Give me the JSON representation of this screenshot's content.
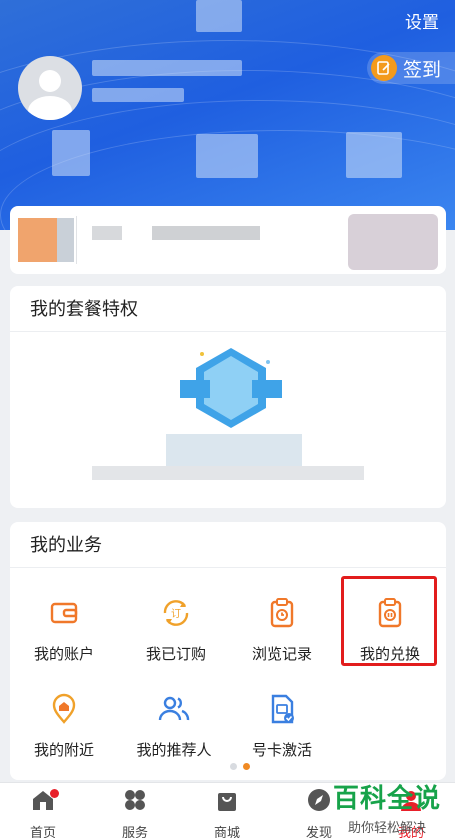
{
  "header": {
    "settings_label": "设置",
    "signin_label": "签到"
  },
  "package": {
    "title": "我的套餐特权"
  },
  "services": {
    "title": "我的业务",
    "items": [
      {
        "label": "我的账户",
        "icon": "wallet-icon"
      },
      {
        "label": "我已订购",
        "icon": "subscribed-icon"
      },
      {
        "label": "浏览记录",
        "icon": "clipboard-clock-icon"
      },
      {
        "label": "我的兑换",
        "icon": "exchange-icon"
      },
      {
        "label": "我的附近",
        "icon": "location-pin-icon"
      },
      {
        "label": "我的推荐人",
        "icon": "users-icon"
      },
      {
        "label": "号卡激活",
        "icon": "sim-card-icon"
      }
    ],
    "highlighted": "我的兑换",
    "page_indicator": {
      "pages": 2,
      "current": 2
    }
  },
  "tabbar": {
    "items": [
      {
        "label": "首页",
        "icon": "home-icon"
      },
      {
        "label": "服务",
        "icon": "grid-icon"
      },
      {
        "label": "商城",
        "icon": "shopping-bag-icon"
      },
      {
        "label": "发现",
        "icon": "compass-icon"
      },
      {
        "label": "我的",
        "icon": "user-icon"
      }
    ]
  },
  "watermark": {
    "line1": "百科全说",
    "line2": "助你轻松解决"
  },
  "colors": {
    "header_blue": "#2f6fd8",
    "accent_orange": "#f08a24",
    "highlight_red": "#e21c1c",
    "icon_blue": "#3a7fe0",
    "watermark_green": "#17a34a"
  }
}
